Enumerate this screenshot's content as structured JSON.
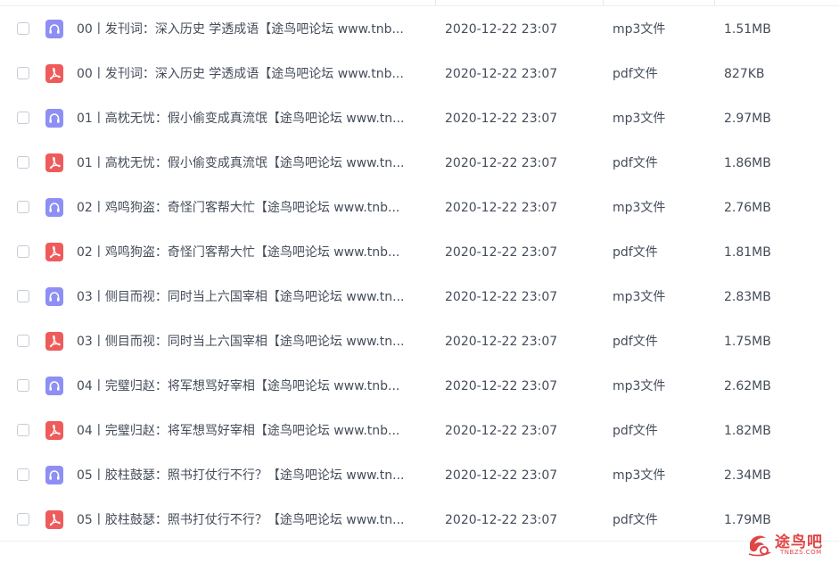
{
  "files": [
    {
      "name": "00丨发刊词：深入历史 学透成语【途鸟吧论坛 www.tnb...",
      "date": "2020-12-22 23:07",
      "type": "mp3文件",
      "size": "1.51MB",
      "icon": "audio-file-icon"
    },
    {
      "name": "00丨发刊词：深入历史 学透成语【途鸟吧论坛 www.tnb...",
      "date": "2020-12-22 23:07",
      "type": "pdf文件",
      "size": "827KB",
      "icon": "pdf-file-icon"
    },
    {
      "name": "01丨高枕无忧：假小偷变成真流氓【途鸟吧论坛 www.tn...",
      "date": "2020-12-22 23:07",
      "type": "mp3文件",
      "size": "2.97MB",
      "icon": "audio-file-icon"
    },
    {
      "name": "01丨高枕无忧：假小偷变成真流氓【途鸟吧论坛 www.tn...",
      "date": "2020-12-22 23:07",
      "type": "pdf文件",
      "size": "1.86MB",
      "icon": "pdf-file-icon"
    },
    {
      "name": "02丨鸡鸣狗盗：奇怪门客帮大忙【途鸟吧论坛 www.tnb...",
      "date": "2020-12-22 23:07",
      "type": "mp3文件",
      "size": "2.76MB",
      "icon": "audio-file-icon"
    },
    {
      "name": "02丨鸡鸣狗盗：奇怪门客帮大忙【途鸟吧论坛 www.tnb...",
      "date": "2020-12-22 23:07",
      "type": "pdf文件",
      "size": "1.81MB",
      "icon": "pdf-file-icon"
    },
    {
      "name": "03丨侧目而视：同时当上六国宰相【途鸟吧论坛 www.tn...",
      "date": "2020-12-22 23:07",
      "type": "mp3文件",
      "size": "2.83MB",
      "icon": "audio-file-icon"
    },
    {
      "name": "03丨侧目而视：同时当上六国宰相【途鸟吧论坛 www.tn...",
      "date": "2020-12-22 23:07",
      "type": "pdf文件",
      "size": "1.75MB",
      "icon": "pdf-file-icon"
    },
    {
      "name": "04丨完璧归赵：将军想骂好宰相【途鸟吧论坛 www.tnb...",
      "date": "2020-12-22 23:07",
      "type": "mp3文件",
      "size": "2.62MB",
      "icon": "audio-file-icon"
    },
    {
      "name": "04丨完璧归赵：将军想骂好宰相【途鸟吧论坛 www.tnb...",
      "date": "2020-12-22 23:07",
      "type": "pdf文件",
      "size": "1.82MB",
      "icon": "pdf-file-icon"
    },
    {
      "name": "05丨胶柱鼓瑟：照书打仗行不行？【途鸟吧论坛 www.tn...",
      "date": "2020-12-22 23:07",
      "type": "mp3文件",
      "size": "2.34MB",
      "icon": "audio-file-icon"
    },
    {
      "name": "05丨胶柱鼓瑟：照书打仗行不行？【途鸟吧论坛 www.tn...",
      "date": "2020-12-22 23:07",
      "type": "pdf文件",
      "size": "1.79MB",
      "icon": "pdf-file-icon"
    }
  ],
  "watermark": {
    "text": "途鸟吧",
    "subtext": "TNBZS.COM"
  },
  "colors": {
    "audio_icon": "#8d8ff5",
    "pdf_icon": "#ef5b5b",
    "text": "#454d5a",
    "watermark": "#e04545"
  }
}
